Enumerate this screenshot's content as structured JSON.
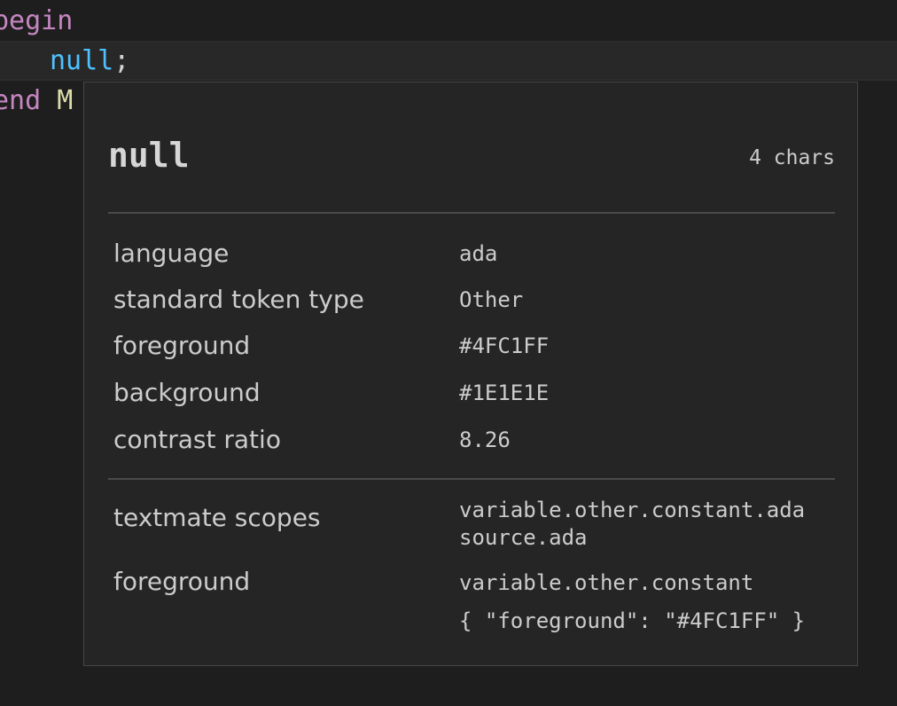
{
  "code": {
    "line1": {
      "keyword": "begin"
    },
    "line2": {
      "indent": "    ",
      "constant": "null",
      "punct": ";"
    },
    "line3": {
      "keyword": "end",
      "ident_visible": "M"
    }
  },
  "hover": {
    "token": "null",
    "char_count": "4 chars",
    "properties": [
      {
        "label": "language",
        "value": "ada"
      },
      {
        "label": "standard token type",
        "value": "Other"
      },
      {
        "label": "foreground",
        "value": "#4FC1FF"
      },
      {
        "label": "background",
        "value": "#1E1E1E"
      },
      {
        "label": "contrast ratio",
        "value": "8.26"
      }
    ],
    "textmate": {
      "label": "textmate scopes",
      "scopes": [
        "variable.other.constant.ada",
        "source.ada"
      ]
    },
    "theme_rule": {
      "label": "foreground",
      "scope": "variable.other.constant",
      "rule": "{ \"foreground\": \"#4FC1FF\" }"
    }
  },
  "colors": {
    "editor_bg": "#1e1e1e",
    "keyword": "#c586c0",
    "constant": "#4fc1ff",
    "identifier": "#dcdcaa",
    "hover_bg": "#252526",
    "hover_border": "#454545"
  }
}
